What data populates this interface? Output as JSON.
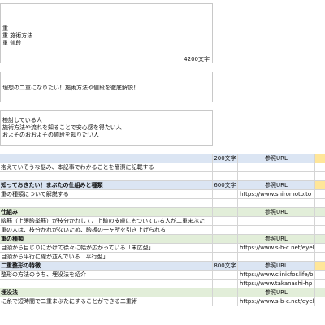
{
  "top_box": {
    "lines": [
      "重",
      "重 施術方法",
      "重 値段"
    ],
    "char_count": "4200文字"
  },
  "title_box": {
    "text": "理想の二重になりたい！施術方法や値段を徹底解説！"
  },
  "target_box": {
    "lines": [
      "検討している人",
      "施術方法や流れを知ることで安心感を得たい人",
      "およそのおおよその値段を知りたい人"
    ]
  },
  "rows": [
    {
      "style": "blue",
      "bold": false,
      "c1": "",
      "c2": "200文字",
      "c3": "参照URL"
    },
    {
      "style": "white",
      "bold": false,
      "c1": "抱えていそうな悩み、本記事でわかることを簡潔に記載する",
      "c2": "",
      "c3": ""
    },
    {
      "style": "white",
      "bold": false,
      "c1": "",
      "c2": "",
      "c3": ""
    },
    {
      "style": "blue",
      "bold": true,
      "c1": "知っておきたい！まぶたの仕組みと種類",
      "c2": "600文字",
      "c3": "参照URL"
    },
    {
      "style": "white",
      "bold": false,
      "c1": "重の種類について解説する",
      "c2": "",
      "c3": "https://www.shiromoto.to"
    },
    {
      "style": "white",
      "bold": false,
      "c1": "",
      "c2": "",
      "c3": ""
    },
    {
      "style": "green",
      "bold": true,
      "c1": "仕組み",
      "c2": "",
      "c3": "参照URL"
    },
    {
      "style": "white",
      "bold": false,
      "c1": "瞼筋（上眼瞼挙筋）が枝分かれして、上瞼の皮膚にもついている人が二重まぶた",
      "c2": "",
      "c3": ""
    },
    {
      "style": "white",
      "bold": false,
      "c1": "重の人は、枝分かれがないため、瞼板の一ヶ所を引き上げられる",
      "c2": "",
      "c3": ""
    },
    {
      "style": "green",
      "bold": true,
      "c1": "重の種類",
      "c2": "",
      "c3": "参照URL"
    },
    {
      "style": "white",
      "bold": false,
      "c1": "目頭から目じりにかけて徐々に幅が広がっている「末広型」",
      "c2": "",
      "c3": "https://www.s-b-c.net/eyeli"
    },
    {
      "style": "white",
      "bold": false,
      "c1": "目頭から平行に線が並んでいる「平行型」",
      "c2": "",
      "c3": ""
    },
    {
      "style": "blue",
      "bold": true,
      "c1": "二重整形の特徴",
      "c2": "800文字",
      "c3": "参照URL"
    },
    {
      "style": "white",
      "bold": false,
      "c1": "整形の方法のうち、埋没法を紹介",
      "c2": "",
      "c3": "https://www.clinicfor.life/b"
    },
    {
      "style": "white",
      "bold": false,
      "c1": "",
      "c2": "",
      "c3": "https://www.takanashi-hp"
    },
    {
      "style": "green",
      "bold": true,
      "c1": "埋没法",
      "c2": "",
      "c3": "参照URL"
    },
    {
      "style": "white",
      "bold": false,
      "c1": "に糸で短時間で二重まぶたにすることができる二重術",
      "c2": "",
      "c3": "https://www.s-b-c.net/eyel"
    }
  ]
}
